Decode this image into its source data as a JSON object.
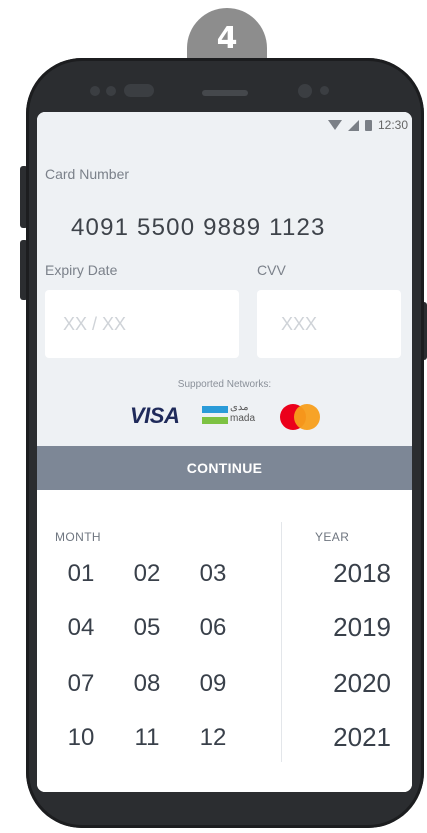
{
  "step": {
    "number": "4"
  },
  "status_bar": {
    "time": "12:30"
  },
  "card": {
    "number_label": "Card Number",
    "number_value": "4091  5500  9889  1123",
    "expiry_label": "Expiry Date",
    "expiry_placeholder": "XX / XX",
    "cvv_label": "CVV",
    "cvv_placeholder": "XXX"
  },
  "networks": {
    "label": "Supported Networks:",
    "items": [
      "VISA",
      "mada",
      "mastercard"
    ],
    "mada_arabic": "مدى"
  },
  "continue_button": {
    "label": "CONTINUE"
  },
  "picker": {
    "month_header": "MONTH",
    "year_header": "YEAR",
    "months": [
      "01",
      "02",
      "03",
      "04",
      "05",
      "06",
      "07",
      "08",
      "09",
      "10",
      "11",
      "12"
    ],
    "years": [
      "2018",
      "2019",
      "2020",
      "2021"
    ]
  },
  "colors": {
    "frame": "#2b2d30",
    "badge": "#8d8d8d",
    "top_background": "#eef1f4",
    "continue_button": "#7d8796",
    "text_primary": "#39404a",
    "label": "#7b818a",
    "visa": "#1f2a5a",
    "mada_blue": "#2a9bd8",
    "mada_green": "#7dc242",
    "mastercard_red": "#eb001b",
    "mastercard_orange": "#f79e1b"
  }
}
